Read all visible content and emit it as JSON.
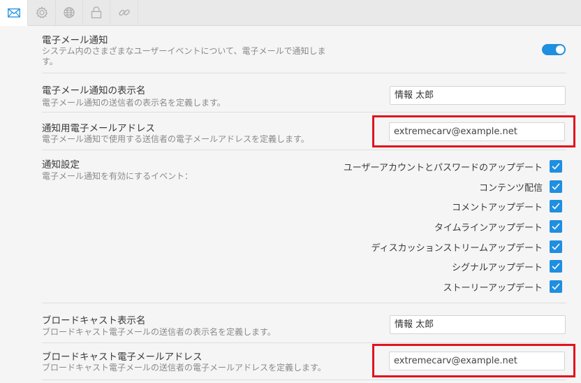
{
  "tabs": [
    {
      "icon": "mail-icon",
      "active": true
    },
    {
      "icon": "gear-icon",
      "active": false
    },
    {
      "icon": "globe-icon",
      "active": false
    },
    {
      "icon": "lock-icon",
      "active": false
    },
    {
      "icon": "link-icon",
      "active": false
    }
  ],
  "email_notification": {
    "title": "電子メール通知",
    "description": "システム内のさまざまなユーザーイベントについて、電子メールで通知しま\nす。",
    "enabled": true
  },
  "display_name": {
    "title": "電子メール通知の表示名",
    "description": "電子メール通知の送信者の表示名を定義します。",
    "value": "情報 太郎"
  },
  "notify_address": {
    "title": "通知用電子メールアドレス",
    "description": "電子メール通知で使用する送信者の電子メールアドレスを定義します。",
    "value": "extremecarv@example.net"
  },
  "notification_settings": {
    "title": "通知設定",
    "description": "電子メール通知を有効にするイベント：",
    "events": [
      {
        "label": "ユーザーアカウントとパスワードのアップデート",
        "checked": true
      },
      {
        "label": "コンテンツ配信",
        "checked": true
      },
      {
        "label": "コメントアップデート",
        "checked": true
      },
      {
        "label": "タイムラインアップデート",
        "checked": true
      },
      {
        "label": "ディスカッションストリームアップデート",
        "checked": true
      },
      {
        "label": "シグナルアップデート",
        "checked": true
      },
      {
        "label": "ストーリーアップデート",
        "checked": true
      }
    ]
  },
  "broadcast_name": {
    "title": "ブロードキャスト表示名",
    "description": "ブロードキャスト電子メールの送信者の表示名を定義します。",
    "value": "情報 太郎"
  },
  "broadcast_address": {
    "title": "ブロードキャスト電子メールアドレス",
    "description": "ブロードキャスト電子メールの送信者の電子メールアドレスを定義します。",
    "value": "extremecarv@example.net"
  },
  "colors": {
    "accent": "#1e8fe1",
    "highlight": "#e0141e"
  }
}
